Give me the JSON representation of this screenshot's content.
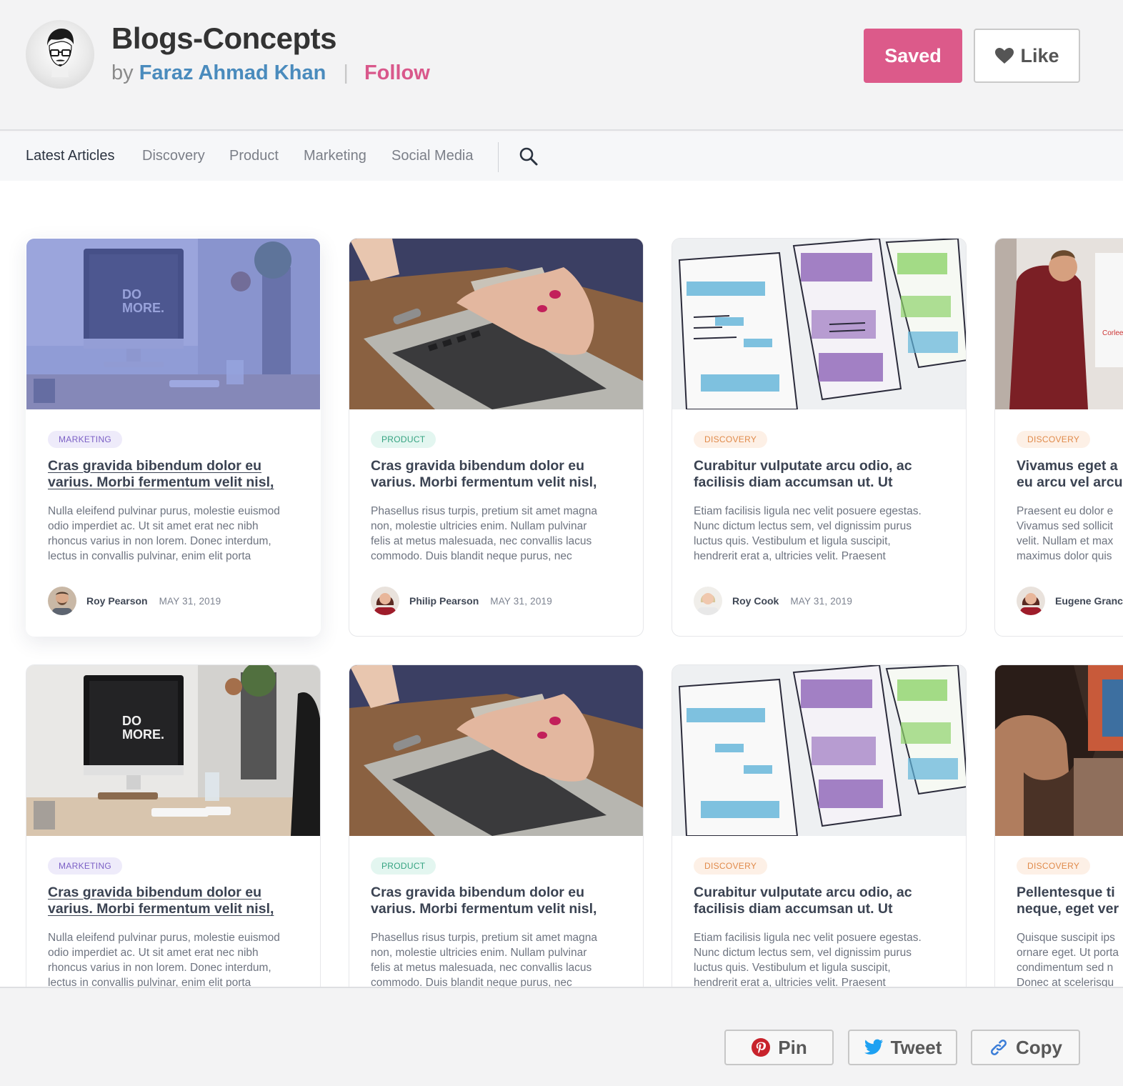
{
  "header": {
    "title": "Blogs-Concepts",
    "by": "by",
    "author": "Faraz Ahmad Khan",
    "separator": "|",
    "follow": "Follow",
    "saved_label": "Saved",
    "like_label": "Like"
  },
  "nav": {
    "items": [
      "Latest Articles",
      "Discovery",
      "Product",
      "Marketing",
      "Social Media"
    ],
    "active": "Latest Articles"
  },
  "cards": [
    {
      "category": "MARKETING",
      "title_lines": [
        "Cras gravida bibendum dolor eu",
        "varius. Morbi fermentum velit nisl,"
      ],
      "excerpt_lines": [
        "Nulla eleifend pulvinar purus, molestie euismod",
        "odio imperdiet ac. Ut sit amet erat nec nibh",
        "rhoncus varius in non lorem. Donec interdum,",
        "lectus in convallis pulvinar, enim elit porta"
      ],
      "author": "Roy Pearson",
      "date": "MAY 31, 2019"
    },
    {
      "category": "PRODUCT",
      "title_lines": [
        "Cras gravida bibendum dolor eu",
        "varius. Morbi fermentum velit nisl,"
      ],
      "excerpt_lines": [
        "Phasellus risus turpis, pretium sit amet magna",
        "non, molestie ultricies enim. Nullam pulvinar",
        "felis at metus malesuada, nec convallis lacus",
        "commodo. Duis blandit neque purus, nec"
      ],
      "author": "Philip Pearson",
      "date": "MAY 31, 2019"
    },
    {
      "category": "DISCOVERY",
      "title_lines": [
        "Curabitur vulputate arcu odio, ac",
        "facilisis diam accumsan ut. Ut"
      ],
      "excerpt_lines": [
        "Etiam facilisis ligula nec velit posuere egestas.",
        "Nunc dictum lectus sem, vel dignissim purus",
        "luctus quis. Vestibulum et ligula suscipit,",
        "hendrerit erat a, ultricies velit. Praesent"
      ],
      "author": "Roy Cook",
      "date": "MAY 31, 2019"
    },
    {
      "category": "DISCOVERY",
      "title_lines": [
        "Vivamus eget a",
        "eu arcu vel arcu"
      ],
      "excerpt_lines": [
        "Praesent eu dolor e",
        "Vivamus sed sollicit",
        "velit. Nullam et max",
        "maximus dolor quis"
      ],
      "author": "Eugene Granc",
      "date": ""
    },
    {
      "category": "MARKETING",
      "title_lines": [
        "Cras gravida bibendum dolor eu",
        "varius. Morbi fermentum velit nisl,"
      ],
      "excerpt_lines": [
        "Nulla eleifend pulvinar purus, molestie euismod",
        "odio imperdiet ac. Ut sit amet erat nec nibh",
        "rhoncus varius in non lorem. Donec interdum,",
        "lectus in convallis pulvinar, enim elit porta"
      ],
      "author": "",
      "date": ""
    },
    {
      "category": "PRODUCT",
      "title_lines": [
        "Cras gravida bibendum dolor eu",
        "varius. Morbi fermentum velit nisl,"
      ],
      "excerpt_lines": [
        "Phasellus risus turpis, pretium sit amet magna",
        "non, molestie ultricies enim. Nullam pulvinar",
        "felis at metus malesuada, nec convallis lacus",
        "commodo. Duis blandit neque purus, nec"
      ],
      "author": "",
      "date": ""
    },
    {
      "category": "DISCOVERY",
      "title_lines": [
        "Curabitur vulputate arcu odio, ac",
        "facilisis diam accumsan ut. Ut"
      ],
      "excerpt_lines": [
        "Etiam facilisis ligula nec velit posuere egestas.",
        "Nunc dictum lectus sem, vel dignissim purus",
        "luctus quis. Vestibulum et ligula suscipit,",
        "hendrerit erat a, ultricies velit. Praesent"
      ],
      "author": "",
      "date": ""
    },
    {
      "category": "DISCOVERY",
      "title_lines": [
        "Pellentesque ti",
        "neque, eget ver"
      ],
      "excerpt_lines": [
        "Quisque suscipit ips",
        "ornare eget. Ut porta",
        "condimentum sed n",
        "Donec at scelerisqu"
      ],
      "author": "",
      "date": ""
    }
  ],
  "footer": {
    "pin_label": "Pin",
    "tweet_label": "Tweet",
    "copy_label": "Copy"
  },
  "colors": {
    "accent_pink": "#dc5a8a",
    "author_blue": "#4a8bbd",
    "tag_marketing": "#7b5fc5",
    "tag_product": "#35a381",
    "tag_discovery": "#e08a4a",
    "pinterest_red": "#c8232c",
    "twitter_blue": "#1da1f2",
    "copy_link_blue": "#3b7dd8"
  }
}
